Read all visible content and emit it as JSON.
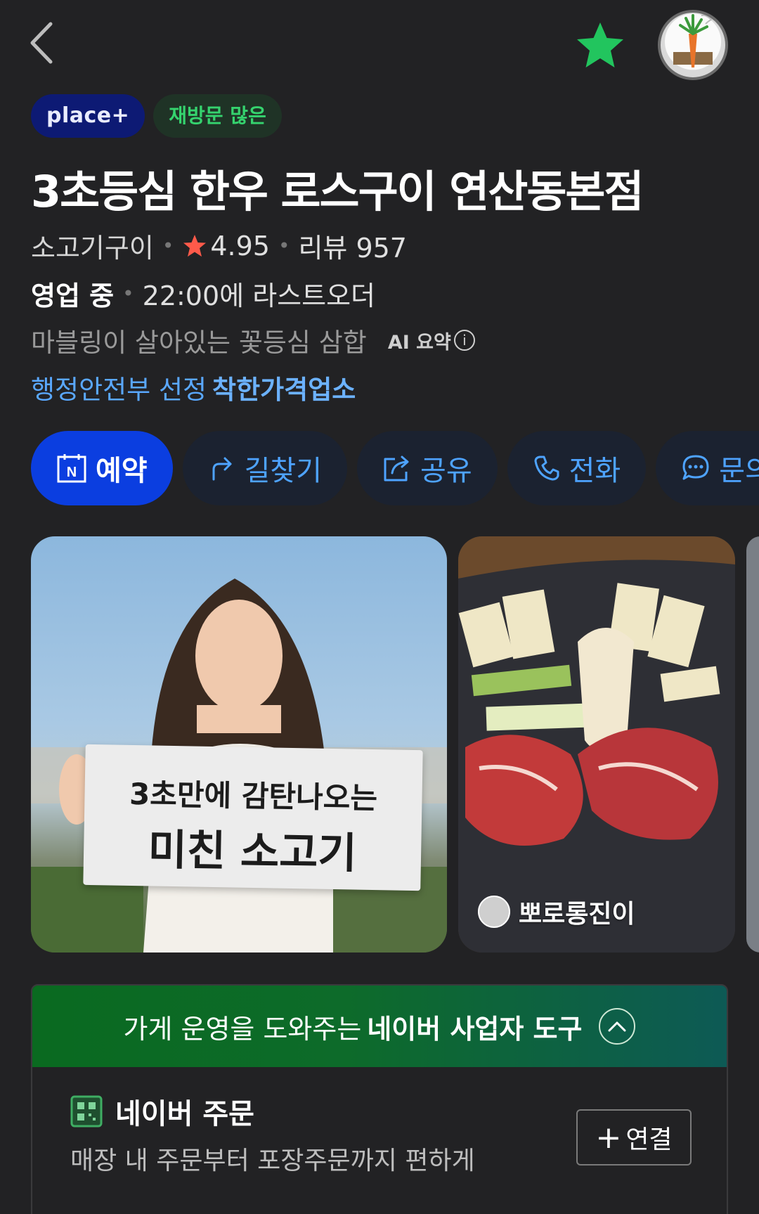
{
  "badges": {
    "place_plus": "place+",
    "revisit": "재방문 많은"
  },
  "place": {
    "name": "3초등심 한우 로스구이 연산동본점",
    "category": "소고기구이",
    "rating": "4.95",
    "review_label": "리뷰 957",
    "status": "영업 중",
    "last_order": "22:00에 라스트오더",
    "ai_summary": "마블링이 살아있는 꽃등심 삼합",
    "ai_label": "AI 요약",
    "gov_prefix": "행정안전부 선정",
    "gov_badge": "착한가격업소"
  },
  "actions": [
    {
      "label": "예약",
      "icon": "naver-booking-icon"
    },
    {
      "label": "길찾기",
      "icon": "directions-icon"
    },
    {
      "label": "공유",
      "icon": "share-icon"
    },
    {
      "label": "전화",
      "icon": "phone-icon"
    },
    {
      "label": "문의",
      "icon": "chat-icon"
    }
  ],
  "photos": {
    "sign_line1": "3초만에 감탄나오는",
    "sign_line2": "미친 소고기",
    "uploader": "뽀로롱진이"
  },
  "biz_tools": {
    "header_prefix": "가게 운영을 도와주는",
    "header_bold": "네이버 사업자 도구",
    "order_title": "네이버 주문",
    "order_desc": "매장 내 주문부터 포장주문까지 편하게",
    "connect_label": "연결"
  },
  "colors": {
    "background": "#222224",
    "accent_blue": "#0b3ee0",
    "link_blue": "#4ea3ff",
    "green_star": "#22c55e",
    "rating_star": "#ff5a4a"
  }
}
